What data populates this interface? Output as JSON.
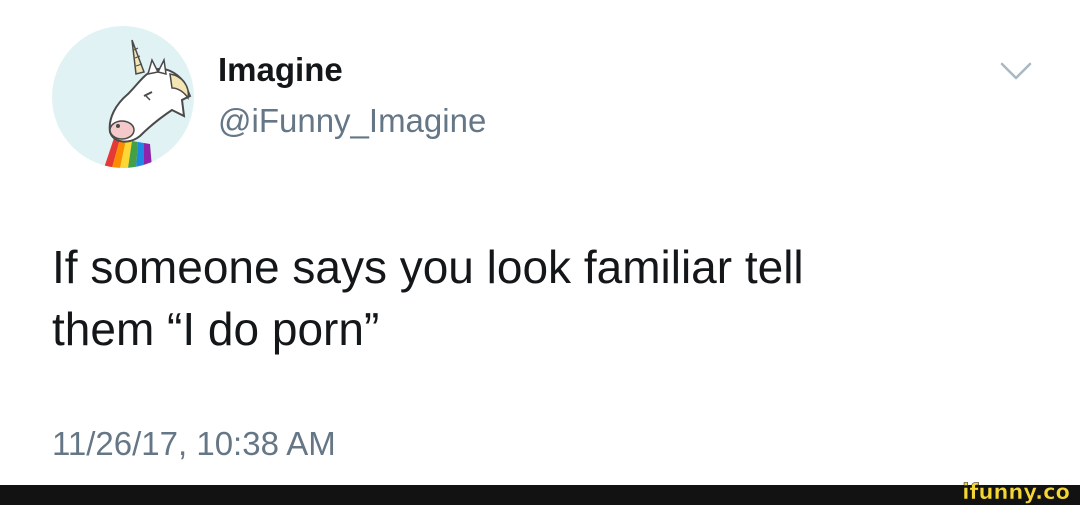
{
  "author": {
    "display_name": "Imagine",
    "handle": "@iFunny_Imagine"
  },
  "tweet": {
    "text_lines": [
      "If someone says you look familiar tell",
      "them “I do porn”"
    ],
    "timestamp": "11/26/17, 10:38 AM"
  },
  "icons": {
    "menu": "chevron-down-icon",
    "avatar": "unicorn-rainbow-avatar"
  },
  "watermark": {
    "text": "ifunny.co"
  },
  "colors": {
    "text_primary": "#14171a",
    "text_secondary": "#657786",
    "avatar_bg": "#e1f2f4",
    "footer_bg": "#121212",
    "watermark": "#f4d635"
  }
}
